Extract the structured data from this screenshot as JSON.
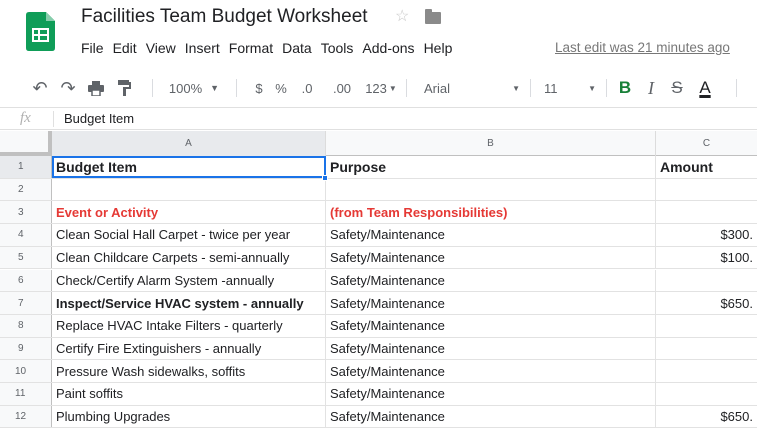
{
  "app": {
    "title": "Facilities Team Budget Worksheet",
    "last_edit": "Last edit was 21 minutes ago",
    "logo_icon": "sheets-logo-icon",
    "accent": "#0f9d58"
  },
  "menu": [
    "File",
    "Edit",
    "View",
    "Insert",
    "Format",
    "Data",
    "Tools",
    "Add-ons",
    "Help"
  ],
  "toolbar": {
    "zoom": "100%",
    "currency": "$",
    "percent": "%",
    "decrease_decimal": ".0",
    "increase_decimal": ".00",
    "more_formats": "123",
    "font": "Arial",
    "font_size": "11",
    "bold": "B",
    "italic": "I",
    "strike": "S",
    "text_color": "A"
  },
  "formula_bar": {
    "fx": "fx",
    "content": "Budget Item"
  },
  "columns": [
    "A",
    "B",
    "C"
  ],
  "rows": [
    {
      "num": "1",
      "a": "Budget Item",
      "b": "Purpose",
      "c": "Amount"
    },
    {
      "num": "2",
      "a": "",
      "b": "",
      "c": ""
    },
    {
      "num": "3",
      "a": "Event or Activity",
      "b": "(from Team Responsibilities)",
      "c": ""
    },
    {
      "num": "4",
      "a": "Clean Social Hall Carpet - twice per year",
      "b": "Safety/Maintenance",
      "c": "$300."
    },
    {
      "num": "5",
      "a": "Clean Childcare Carpets - semi-annually",
      "b": "Safety/Maintenance",
      "c": "$100."
    },
    {
      "num": "6",
      "a": "Check/Certify Alarm System -annually",
      "b": "Safety/Maintenance",
      "c": ""
    },
    {
      "num": "7",
      "a": "Inspect/Service HVAC system - annually",
      "b": "Safety/Maintenance",
      "c": "$650."
    },
    {
      "num": "8",
      "a": "Replace HVAC Intake Filters - quarterly",
      "b": "Safety/Maintenance",
      "c": ""
    },
    {
      "num": "9",
      "a": "Certify Fire Extinguishers - annually",
      "b": "Safety/Maintenance",
      "c": ""
    },
    {
      "num": "10",
      "a": "Pressure Wash sidewalks, soffits",
      "b": "Safety/Maintenance",
      "c": ""
    },
    {
      "num": "11",
      "a": "Paint soffits",
      "b": "Safety/Maintenance",
      "c": ""
    },
    {
      "num": "12",
      "a": "Plumbing Upgrades",
      "b": "Safety/Maintenance",
      "c": "$650."
    }
  ]
}
